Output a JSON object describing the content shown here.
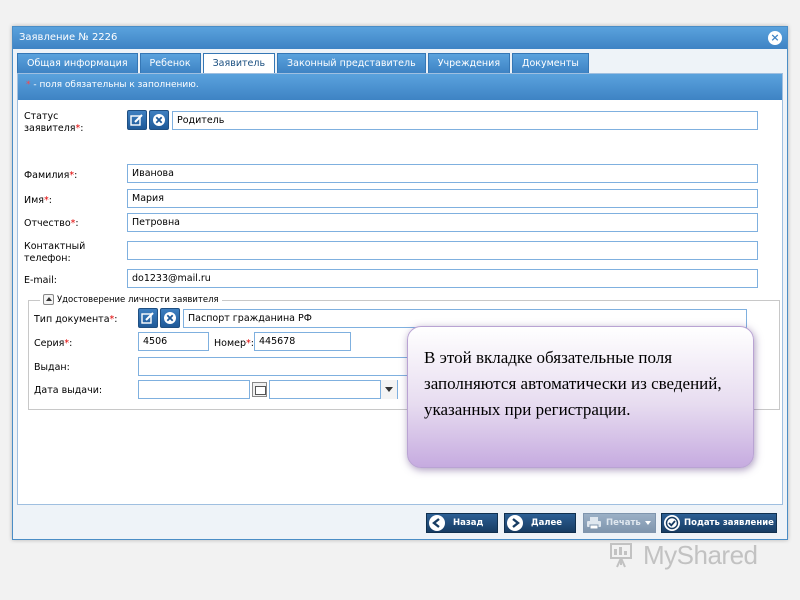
{
  "window": {
    "title": "Заявление № 2226",
    "close_glyph": "×"
  },
  "tabs": [
    {
      "label": "Общая информация",
      "active": false
    },
    {
      "label": "Ребенок",
      "active": false
    },
    {
      "label": "Заявитель",
      "active": true
    },
    {
      "label": "Законный представитель",
      "active": false
    },
    {
      "label": "Учреждения",
      "active": false
    },
    {
      "label": "Документы",
      "active": false
    }
  ],
  "required_note": {
    "star": "*",
    "text": " - поля обязательны к заполнению."
  },
  "applicant": {
    "status_label_1": "Статус",
    "status_label_2": "заявителя",
    "status_value": "Родитель",
    "lastname_label": "Фамилия",
    "lastname_value": "Иванова",
    "firstname_label": "Имя",
    "firstname_value": "Мария",
    "middlename_label": "Отчество",
    "middlename_value": "Петровна",
    "phone_label_1": "Контактный",
    "phone_label_2": "телефон:",
    "phone_value": "",
    "email_label": "E-mail:",
    "email_value": "do1233@mail.ru",
    "star": "*",
    "colon": ":"
  },
  "id_document": {
    "legend": "Удостоверение личности заявителя",
    "doctype_label": "Тип документа",
    "doctype_value": "Паспорт гражданина РФ",
    "series_label": "Серия",
    "series_value": "4506",
    "number_label": "Номер",
    "number_value": "445678",
    "issued_by_label": "Выдан:",
    "issued_by_value": "",
    "issue_date_label": "Дата выдачи:",
    "issue_date_value": "",
    "issue_time_value": ""
  },
  "buttons": {
    "back": "Назад",
    "next": "Далее",
    "print": "Печать",
    "submit": "Подать заявление"
  },
  "callout": {
    "text": "В этой вкладке обязательные поля заполняются автоматически из сведений, указанных при регистрации."
  },
  "watermark": {
    "text": "MyShared"
  },
  "colors": {
    "header_blue": "#3e83c4",
    "field_border": "#7fb0df",
    "button_dark": "#173c63",
    "required_star": "#e00000",
    "callout_purple": "#c6abe0"
  }
}
